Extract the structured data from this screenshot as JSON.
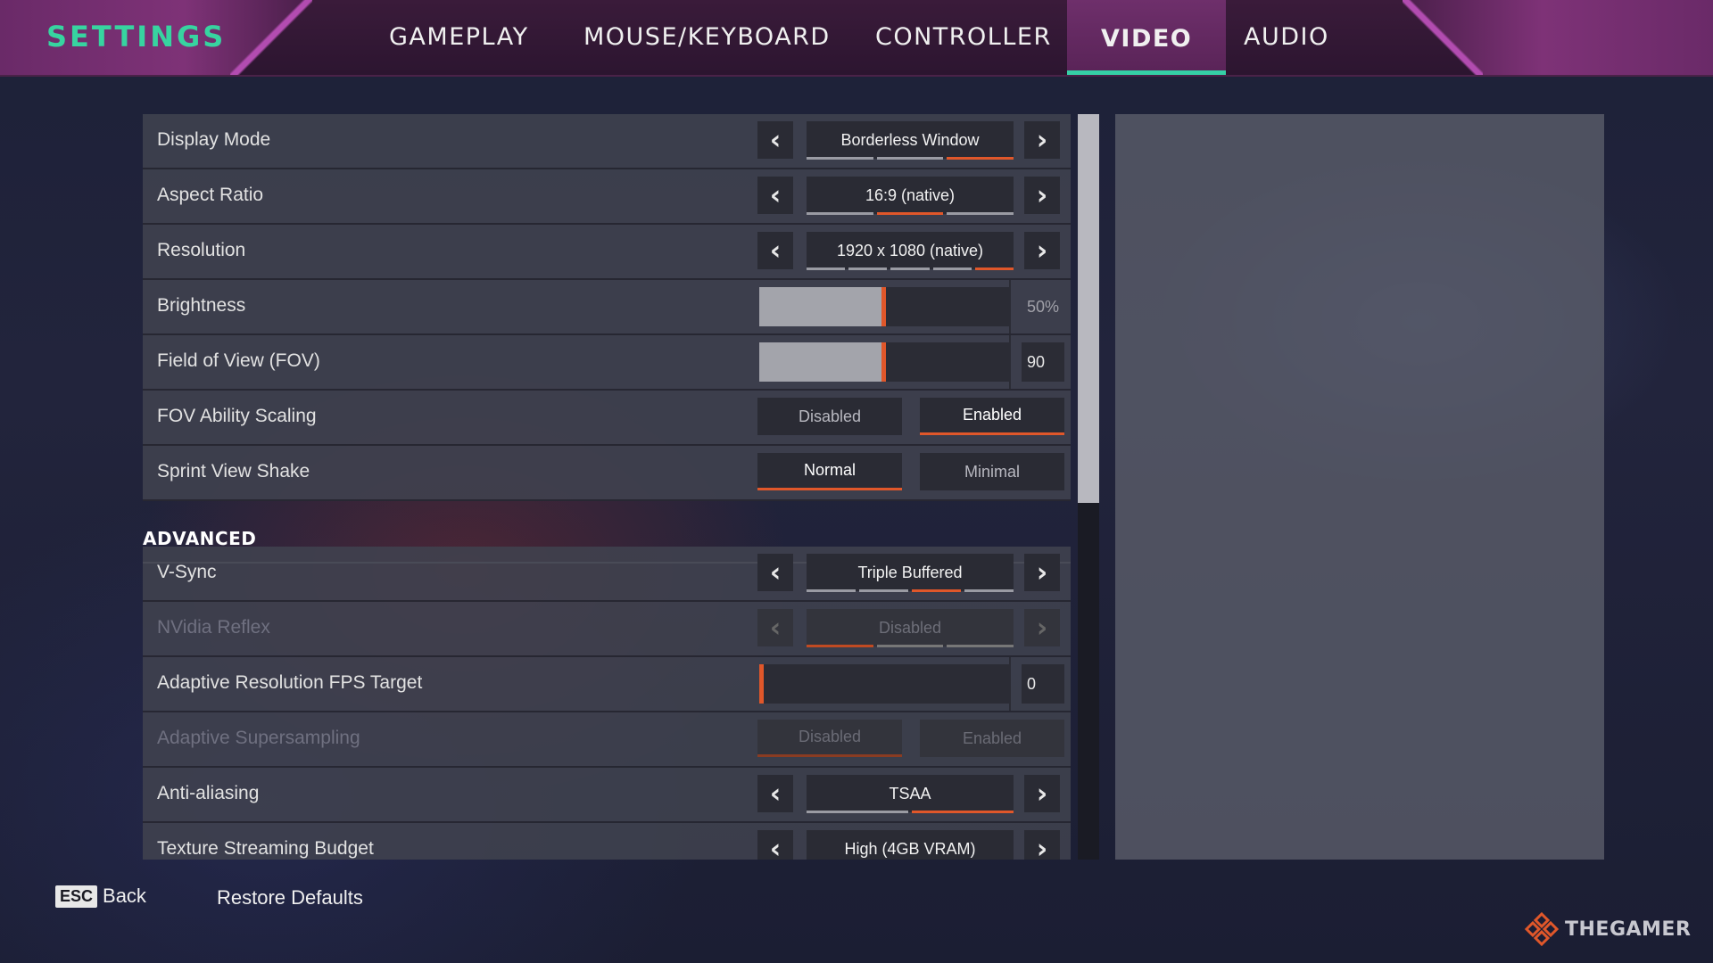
{
  "header": {
    "title": "SETTINGS",
    "tabs": [
      {
        "label": "GAMEPLAY"
      },
      {
        "label": "MOUSE/KEYBOARD"
      },
      {
        "label": "CONTROLLER"
      },
      {
        "label": "VIDEO"
      },
      {
        "label": "AUDIO"
      }
    ],
    "active_tab": "VIDEO"
  },
  "settings": {
    "display_mode": {
      "label": "Display Mode",
      "value": "Borderless Window",
      "option_count": 3,
      "selected_index": 2
    },
    "aspect_ratio": {
      "label": "Aspect Ratio",
      "value": "16:9 (native)",
      "option_count": 3,
      "selected_index": 1
    },
    "resolution": {
      "label": "Resolution",
      "value": "1920 x 1080 (native)",
      "option_count": 5,
      "selected_index": 4
    },
    "brightness": {
      "label": "Brightness",
      "value_text": "50%",
      "fraction": 0.5
    },
    "fov": {
      "label": "Field of View (FOV)",
      "value_text": "90",
      "fraction": 0.5
    },
    "fov_ability_scaling": {
      "label": "FOV Ability Scaling",
      "option_a": "Disabled",
      "option_b": "Enabled",
      "selected": "b"
    },
    "sprint_view_shake": {
      "label": "Sprint View Shake",
      "option_a": "Normal",
      "option_b": "Minimal",
      "selected": "a"
    }
  },
  "advanced": {
    "header": "ADVANCED",
    "vsync": {
      "label": "V-Sync",
      "value": "Triple Buffered",
      "option_count": 4,
      "selected_index": 2
    },
    "nvidia_reflex": {
      "label": "NVidia Reflex",
      "value": "Disabled",
      "option_count": 3,
      "selected_index": 0,
      "disabled": true
    },
    "adaptive_res_fps": {
      "label": "Adaptive Resolution FPS Target",
      "value_text": "0",
      "fraction": 0.0
    },
    "adaptive_supersampling": {
      "label": "Adaptive Supersampling",
      "option_a": "Disabled",
      "option_b": "Enabled",
      "selected": "a",
      "disabled": true
    },
    "anti_aliasing": {
      "label": "Anti-aliasing",
      "value": "TSAA",
      "option_count": 2,
      "selected_index": 1
    },
    "texture_streaming_budget": {
      "label": "Texture Streaming Budget",
      "value": "High (4GB VRAM)"
    }
  },
  "footer": {
    "esc_key": "ESC",
    "back_label": "Back",
    "restore_label": "Restore Defaults",
    "brand": "THEGAMER"
  },
  "colors": {
    "accent_orange": "#e0572a",
    "accent_teal": "#37d4a0",
    "header_purple": "#7e3277"
  }
}
